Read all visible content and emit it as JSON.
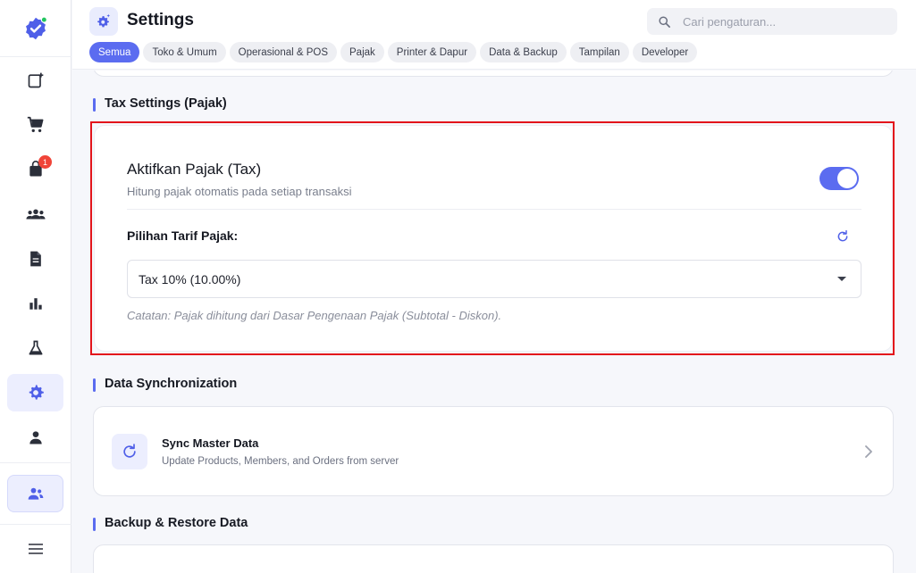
{
  "header": {
    "title": "Settings",
    "search_placeholder": "Cari pengaturan...",
    "tabs": [
      {
        "label": "Semua",
        "active": true
      },
      {
        "label": "Toko & Umum"
      },
      {
        "label": "Operasional & POS"
      },
      {
        "label": "Pajak"
      },
      {
        "label": "Printer & Dapur"
      },
      {
        "label": "Data & Backup"
      },
      {
        "label": "Tampilan"
      },
      {
        "label": "Developer"
      }
    ]
  },
  "sidebar": {
    "items": [
      {
        "icon": "new-order-icon"
      },
      {
        "icon": "cart-icon"
      },
      {
        "icon": "bag-icon",
        "badge": "1"
      },
      {
        "icon": "people-icon"
      },
      {
        "icon": "document-icon"
      },
      {
        "icon": "bar-chart-icon"
      },
      {
        "icon": "flask-icon"
      },
      {
        "icon": "gear-icon",
        "active": true
      },
      {
        "icon": "person-icon"
      }
    ],
    "bottom": [
      {
        "icon": "user-switch-icon"
      },
      {
        "icon": "menu-icon"
      }
    ]
  },
  "tax": {
    "section_title": "Tax Settings (Pajak)",
    "toggle_title": "Aktifkan Pajak (Tax)",
    "toggle_subtitle": "Hitung pajak otomatis pada setiap transaksi",
    "enabled": true,
    "rate_label": "Pilihan Tarif Pajak:",
    "selected_rate": "Tax 10% (10.00%)",
    "note": "Catatan: Pajak dihitung dari Dasar Pengenaan Pajak (Subtotal - Diskon)."
  },
  "sync": {
    "section_title": "Data Synchronization",
    "title": "Sync Master Data",
    "description": "Update Products, Members, and Orders from server"
  },
  "backup": {
    "section_title": "Backup & Restore Data"
  },
  "colors": {
    "accent": "#5b6cf0",
    "highlight_border": "#e3141b",
    "badge": "#f04438"
  }
}
